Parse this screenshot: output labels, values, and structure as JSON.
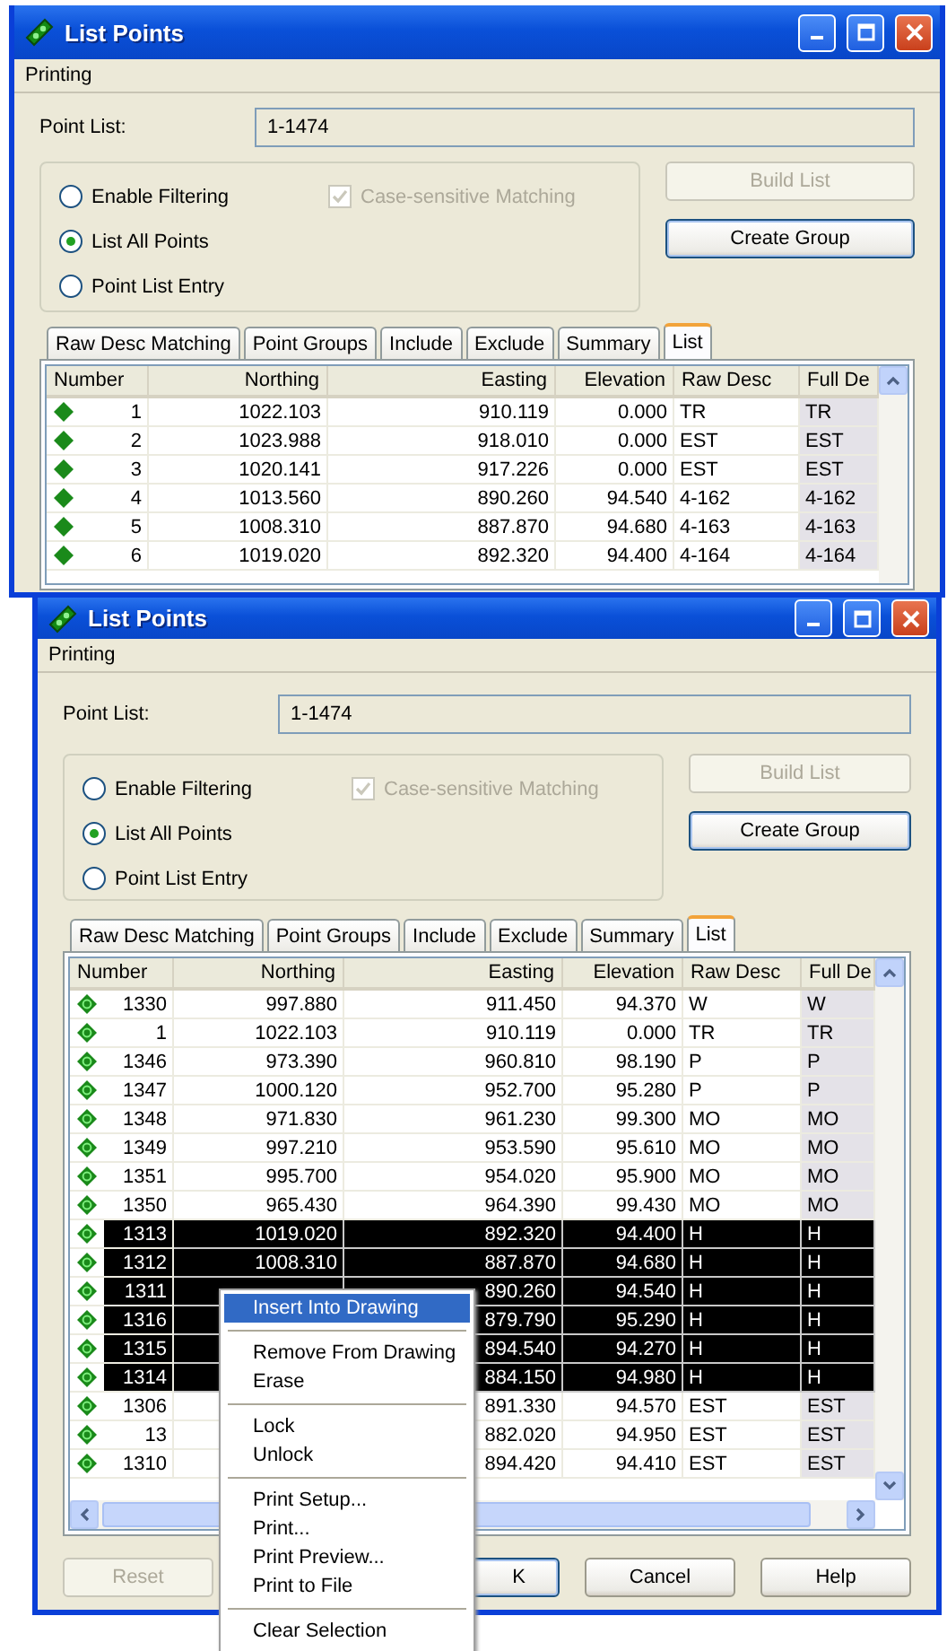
{
  "windows": [
    {
      "title": "List Points",
      "menu": [
        "Printing"
      ],
      "point_list": {
        "label": "Point List:",
        "value": "1-1474"
      },
      "options": [
        {
          "label": "Enable Filtering",
          "selected": false
        },
        {
          "label": "List All Points",
          "selected": true
        },
        {
          "label": "Point List Entry",
          "selected": false
        }
      ],
      "case_sensitive": {
        "label": "Case-sensitive Matching",
        "checked": true,
        "disabled": true
      },
      "side_buttons": [
        {
          "label": "Build List",
          "disabled": true,
          "default": false
        },
        {
          "label": "Create Group",
          "disabled": false,
          "default": true
        }
      ],
      "tabs": [
        {
          "label": "Raw Desc Matching",
          "selected": false
        },
        {
          "label": "Point Groups",
          "selected": false
        },
        {
          "label": "Include",
          "selected": false
        },
        {
          "label": "Exclude",
          "selected": false
        },
        {
          "label": "Summary",
          "selected": false
        },
        {
          "label": "List",
          "selected": true
        }
      ],
      "table": {
        "columns": [
          "Number",
          "Northing",
          "Easting",
          "Elevation",
          "Raw Desc",
          "Full De"
        ],
        "rows": [
          {
            "number": "1",
            "northing": "1022.103",
            "easting": "910.119",
            "elevation": "0.000",
            "raw_desc": "TR",
            "full_desc": "TR",
            "selected": false
          },
          {
            "number": "2",
            "northing": "1023.988",
            "easting": "918.010",
            "elevation": "0.000",
            "raw_desc": "EST",
            "full_desc": "EST",
            "selected": false
          },
          {
            "number": "3",
            "northing": "1020.141",
            "easting": "917.226",
            "elevation": "0.000",
            "raw_desc": "EST",
            "full_desc": "EST",
            "selected": false
          },
          {
            "number": "4",
            "northing": "1013.560",
            "easting": "890.260",
            "elevation": "94.540",
            "raw_desc": "4-162",
            "full_desc": "4-162",
            "selected": false
          },
          {
            "number": "5",
            "northing": "1008.310",
            "easting": "887.870",
            "elevation": "94.680",
            "raw_desc": "4-163",
            "full_desc": "4-163",
            "selected": false
          },
          {
            "number": "6",
            "northing": "1019.020",
            "easting": "892.320",
            "elevation": "94.400",
            "raw_desc": "4-164",
            "full_desc": "4-164",
            "selected": false
          }
        ]
      }
    },
    {
      "title": "List Points",
      "menu": [
        "Printing"
      ],
      "point_list": {
        "label": "Point List:",
        "value": "1-1474"
      },
      "options": [
        {
          "label": "Enable Filtering",
          "selected": false
        },
        {
          "label": "List All Points",
          "selected": true
        },
        {
          "label": "Point List Entry",
          "selected": false
        }
      ],
      "case_sensitive": {
        "label": "Case-sensitive Matching",
        "checked": true,
        "disabled": true
      },
      "side_buttons": [
        {
          "label": "Build List",
          "disabled": true,
          "default": false
        },
        {
          "label": "Create Group",
          "disabled": false,
          "default": true
        }
      ],
      "tabs": [
        {
          "label": "Raw Desc Matching",
          "selected": false
        },
        {
          "label": "Point Groups",
          "selected": false
        },
        {
          "label": "Include",
          "selected": false
        },
        {
          "label": "Exclude",
          "selected": false
        },
        {
          "label": "Summary",
          "selected": false
        },
        {
          "label": "List",
          "selected": true
        }
      ],
      "table": {
        "columns": [
          "Number",
          "Northing",
          "Easting",
          "Elevation",
          "Raw Desc",
          "Full De"
        ],
        "rows": [
          {
            "number": "1330",
            "northing": "997.880",
            "easting": "911.450",
            "elevation": "94.370",
            "raw_desc": "W",
            "full_desc": "W",
            "selected": false
          },
          {
            "number": "1",
            "northing": "1022.103",
            "easting": "910.119",
            "elevation": "0.000",
            "raw_desc": "TR",
            "full_desc": "TR",
            "selected": false
          },
          {
            "number": "1346",
            "northing": "973.390",
            "easting": "960.810",
            "elevation": "98.190",
            "raw_desc": "P",
            "full_desc": "P",
            "selected": false
          },
          {
            "number": "1347",
            "northing": "1000.120",
            "easting": "952.700",
            "elevation": "95.280",
            "raw_desc": "P",
            "full_desc": "P",
            "selected": false
          },
          {
            "number": "1348",
            "northing": "971.830",
            "easting": "961.230",
            "elevation": "99.300",
            "raw_desc": "MO",
            "full_desc": "MO",
            "selected": false
          },
          {
            "number": "1349",
            "northing": "997.210",
            "easting": "953.590",
            "elevation": "95.610",
            "raw_desc": "MO",
            "full_desc": "MO",
            "selected": false
          },
          {
            "number": "1351",
            "northing": "995.700",
            "easting": "954.020",
            "elevation": "95.900",
            "raw_desc": "MO",
            "full_desc": "MO",
            "selected": false
          },
          {
            "number": "1350",
            "northing": "965.430",
            "easting": "964.390",
            "elevation": "99.430",
            "raw_desc": "MO",
            "full_desc": "MO",
            "selected": false
          },
          {
            "number": "1313",
            "northing": "1019.020",
            "easting": "892.320",
            "elevation": "94.400",
            "raw_desc": "H",
            "full_desc": "H",
            "selected": true
          },
          {
            "number": "1312",
            "northing": "1008.310",
            "easting": "887.870",
            "elevation": "94.680",
            "raw_desc": "H",
            "full_desc": "H",
            "selected": true
          },
          {
            "number": "1311",
            "easting": "890.260",
            "elevation": "94.540",
            "raw_desc": "H",
            "full_desc": "H",
            "selected": true
          },
          {
            "number": "1316",
            "easting": "879.790",
            "elevation": "95.290",
            "raw_desc": "H",
            "full_desc": "H",
            "selected": true
          },
          {
            "number": "1315",
            "easting": "894.540",
            "elevation": "94.270",
            "raw_desc": "H",
            "full_desc": "H",
            "selected": true
          },
          {
            "number": "1314",
            "easting": "884.150",
            "elevation": "94.980",
            "raw_desc": "H",
            "full_desc": "H",
            "selected": true
          },
          {
            "number": "1306",
            "easting": "891.330",
            "elevation": "94.570",
            "raw_desc": "EST",
            "full_desc": "EST",
            "selected": false
          },
          {
            "number": "13",
            "easting": "882.020",
            "elevation": "94.950",
            "raw_desc": "EST",
            "full_desc": "EST",
            "selected": false
          },
          {
            "number": "1310",
            "easting": "894.420",
            "elevation": "94.410",
            "raw_desc": "EST",
            "full_desc": "EST",
            "selected": false
          }
        ]
      },
      "bottom_buttons": [
        {
          "label": "Reset",
          "disabled": true,
          "default": false
        },
        {
          "label": "K",
          "disabled": false,
          "default": true
        },
        {
          "label": "Cancel",
          "disabled": false,
          "default": false
        },
        {
          "label": "Help",
          "disabled": false,
          "default": false
        }
      ]
    }
  ],
  "context_menu": [
    {
      "kind": "item",
      "label": "Insert Into Drawing",
      "selected": true
    },
    {
      "kind": "separator"
    },
    {
      "kind": "item",
      "label": "Remove From Drawing",
      "selected": false
    },
    {
      "kind": "item",
      "label": "Erase",
      "selected": false
    },
    {
      "kind": "separator"
    },
    {
      "kind": "item",
      "label": "Lock",
      "selected": false
    },
    {
      "kind": "item",
      "label": "Unlock",
      "selected": false
    },
    {
      "kind": "separator"
    },
    {
      "kind": "item",
      "label": "Print Setup...",
      "selected": false
    },
    {
      "kind": "item",
      "label": "Print...",
      "selected": false
    },
    {
      "kind": "item",
      "label": "Print Preview...",
      "selected": false
    },
    {
      "kind": "item",
      "label": "Print to File",
      "selected": false
    },
    {
      "kind": "separator"
    },
    {
      "kind": "item",
      "label": "Clear Selection",
      "selected": false
    }
  ]
}
